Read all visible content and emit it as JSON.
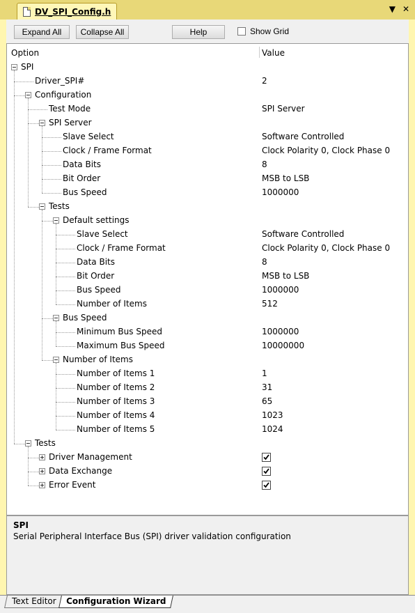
{
  "tab": {
    "title": "DV_SPI_Config.h"
  },
  "window_buttons": {
    "dropdown": "▼",
    "close": "✕"
  },
  "toolbar": {
    "expand_all": "Expand All",
    "collapse_all": "Collapse All",
    "help": "Help",
    "show_grid": "Show Grid",
    "show_grid_checked": false
  },
  "columns": {
    "option": "Option",
    "value": "Value"
  },
  "tree": [
    {
      "label": "SPI",
      "value": "",
      "level": 0,
      "expander": "minus"
    },
    {
      "label": "Driver_SPI#",
      "value": "2",
      "level": 1,
      "expander": ""
    },
    {
      "label": "Configuration",
      "value": "",
      "level": 1,
      "expander": "minus"
    },
    {
      "label": "Test Mode",
      "value": "SPI Server",
      "level": 2,
      "expander": ""
    },
    {
      "label": "SPI Server",
      "value": "",
      "level": 2,
      "expander": "minus"
    },
    {
      "label": "Slave Select",
      "value": "Software Controlled",
      "level": 3,
      "expander": ""
    },
    {
      "label": "Clock / Frame Format",
      "value": "Clock Polarity 0, Clock Phase 0",
      "level": 3,
      "expander": ""
    },
    {
      "label": "Data Bits",
      "value": "8",
      "level": 3,
      "expander": ""
    },
    {
      "label": "Bit Order",
      "value": "MSB to LSB",
      "level": 3,
      "expander": ""
    },
    {
      "label": "Bus Speed",
      "value": "1000000",
      "level": 3,
      "expander": ""
    },
    {
      "label": "Tests",
      "value": "",
      "level": 2,
      "expander": "minus"
    },
    {
      "label": "Default settings",
      "value": "",
      "level": 3,
      "expander": "minus"
    },
    {
      "label": "Slave Select",
      "value": "Software Controlled",
      "level": 4,
      "expander": ""
    },
    {
      "label": "Clock / Frame Format",
      "value": "Clock Polarity 0, Clock Phase 0",
      "level": 4,
      "expander": ""
    },
    {
      "label": "Data Bits",
      "value": "8",
      "level": 4,
      "expander": ""
    },
    {
      "label": "Bit Order",
      "value": "MSB to LSB",
      "level": 4,
      "expander": ""
    },
    {
      "label": "Bus Speed",
      "value": "1000000",
      "level": 4,
      "expander": ""
    },
    {
      "label": "Number of Items",
      "value": "512",
      "level": 4,
      "expander": ""
    },
    {
      "label": "Bus Speed",
      "value": "",
      "level": 3,
      "expander": "minus"
    },
    {
      "label": "Minimum Bus Speed",
      "value": "1000000",
      "level": 4,
      "expander": ""
    },
    {
      "label": "Maximum Bus Speed",
      "value": "10000000",
      "level": 4,
      "expander": ""
    },
    {
      "label": "Number of Items",
      "value": "",
      "level": 3,
      "expander": "minus"
    },
    {
      "label": "Number of Items 1",
      "value": "1",
      "level": 4,
      "expander": ""
    },
    {
      "label": "Number of Items 2",
      "value": "31",
      "level": 4,
      "expander": ""
    },
    {
      "label": "Number of Items 3",
      "value": "65",
      "level": 4,
      "expander": ""
    },
    {
      "label": "Number of Items 4",
      "value": "1023",
      "level": 4,
      "expander": ""
    },
    {
      "label": "Number of Items 5",
      "value": "1024",
      "level": 4,
      "expander": ""
    },
    {
      "label": "Tests",
      "value": "",
      "level": 1,
      "expander": "minus"
    },
    {
      "label": "Driver Management",
      "value": "",
      "level": 2,
      "expander": "plus",
      "checked": true
    },
    {
      "label": "Data Exchange",
      "value": "",
      "level": 2,
      "expander": "plus",
      "checked": true
    },
    {
      "label": "Error Event",
      "value": "",
      "level": 2,
      "expander": "plus",
      "checked": true
    }
  ],
  "description": {
    "title": "SPI",
    "text": "Serial Peripheral Interface Bus (SPI) driver validation configuration"
  },
  "bottom_tabs": [
    {
      "label": "Text Editor",
      "active": false
    },
    {
      "label": "Configuration Wizard",
      "active": true
    }
  ]
}
